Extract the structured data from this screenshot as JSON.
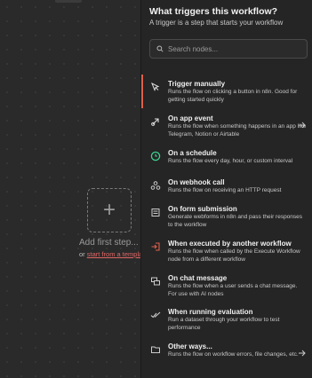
{
  "canvas": {
    "add_first_label": "Add first step...",
    "or_text": "or",
    "template_link": "start from a template"
  },
  "panel": {
    "title": "What triggers this workflow?",
    "subtitle": "A trigger is a step that starts your workflow",
    "search_placeholder": "Search nodes..."
  },
  "items": [
    {
      "title": "Trigger manually",
      "desc": "Runs the flow on clicking a button in n8n. Good for getting started quickly",
      "icon": "cursor-click-icon"
    },
    {
      "title": "On app event",
      "desc": "Runs the flow when something happens in an app like Telegram, Notion or Airtable",
      "icon": "app-event-icon"
    },
    {
      "title": "On a schedule",
      "desc": "Runs the flow every day, hour, or custom interval",
      "icon": "clock-icon"
    },
    {
      "title": "On webhook call",
      "desc": "Runs the flow on receiving an HTTP request",
      "icon": "webhook-icon"
    },
    {
      "title": "On form submission",
      "desc": "Generate webforms in n8n and pass their responses to the workflow",
      "icon": "form-icon"
    },
    {
      "title": "When executed by another workflow",
      "desc": "Runs the flow when called by the Execute Workflow node from a different workflow",
      "icon": "sign-in-icon"
    },
    {
      "title": "On chat message",
      "desc": "Runs the flow when a user sends a chat message. For use with AI nodes",
      "icon": "chat-icon"
    },
    {
      "title": "When running evaluation",
      "desc": "Run a dataset through your workflow to test performance",
      "icon": "check-double-icon"
    },
    {
      "title": "Other ways...",
      "desc": "Runs the flow on workflow errors, file changes, etc.",
      "icon": "folder-icon"
    }
  ],
  "colors": {
    "accent": "#e0604a",
    "schedule_icon": "#3ecf8e",
    "executed_icon": "#e0604a"
  }
}
